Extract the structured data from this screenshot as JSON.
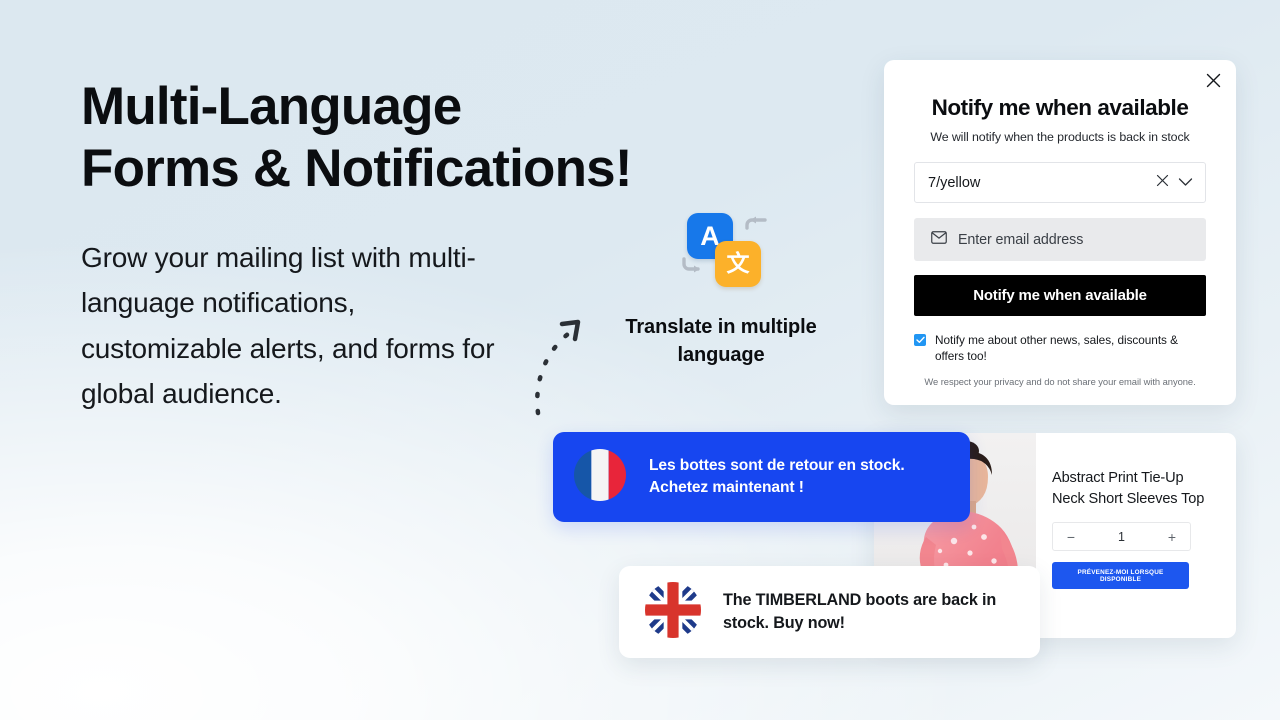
{
  "hero": {
    "title_line1": "Multi-Language",
    "title_line2": "Forms & Notifications!",
    "subtitle": "Grow your mailing list with multi-language notifications, customizable alerts, and forms for global audience."
  },
  "translate_badge": {
    "tile_latin": "A",
    "tile_cjk": "文",
    "caption_line1": "Translate in multiple",
    "caption_line2": "language",
    "icon_blue": "#1778ea",
    "icon_yellow": "#fcb12a",
    "arrow_icon": "curved-arrow-icon",
    "pointer_icon": "dashed-arrow-icon"
  },
  "notify_modal": {
    "close_icon": "close-icon",
    "title": "Notify me when available",
    "subtitle": "We will notify when the products is back in stock",
    "variant": {
      "value": "7/yellow",
      "clear_icon": "clear-icon",
      "chevron_icon": "chevron-down-icon"
    },
    "email": {
      "icon": "envelope-icon",
      "placeholder": "Enter email address",
      "value": ""
    },
    "submit_label": "Notify me when available",
    "consent": {
      "checked": true,
      "label": "Notify me about other news, sales, discounts & offers too!",
      "check_icon": "check-icon",
      "accent": "#2196f3"
    },
    "privacy_note": "We respect your privacy and do not share your email with anyone."
  },
  "product_card": {
    "image_alt": "model-wearing-pink-floral-top",
    "title": "Abstract Print Tie-Up Neck Short Sleeves Top",
    "quantity": {
      "decrease_label": "−",
      "value": "1",
      "increase_label": "+"
    },
    "cta_label": "PRÉVENEZ-MOI LORSQUE DISPONIBLE",
    "cta_color": "#1d57ef"
  },
  "notifications": [
    {
      "language": "french",
      "flag_icon": "flag-france-icon",
      "text_line1": "Les bottes  sont de retour en stock.",
      "text_line2": "Achetez maintenant !",
      "background": "#1746f0",
      "text_color": "#ffffff"
    },
    {
      "language": "english",
      "flag_icon": "flag-united-kingdom-icon",
      "text_line1": "The TIMBERLAND boots are back in",
      "text_line2": "stock. Buy now!",
      "background": "#ffffff",
      "text_color": "#15181c"
    }
  ]
}
